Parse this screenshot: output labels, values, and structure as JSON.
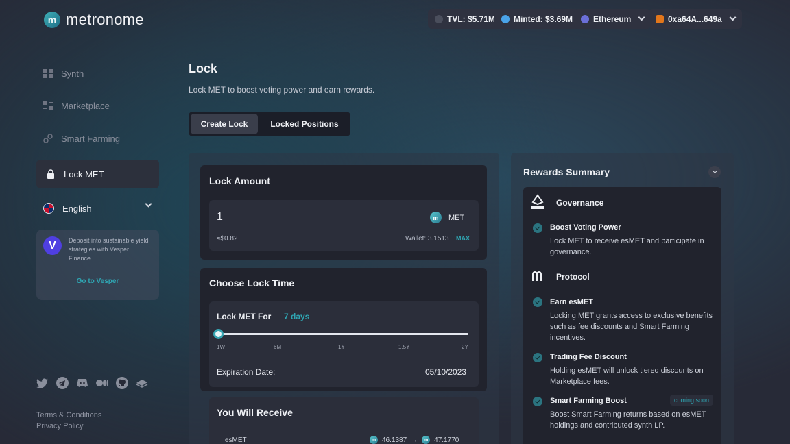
{
  "header": {
    "brand": "metronome",
    "tvl": "TVL: $5.71M",
    "minted": "Minted: $3.69M",
    "network": "Ethereum",
    "wallet": "0xa64A...649a"
  },
  "sidebar": {
    "items": [
      {
        "label": "Synth",
        "icon": "grid-icon"
      },
      {
        "label": "Marketplace",
        "icon": "marketplace-icon"
      },
      {
        "label": "Smart Farming",
        "icon": "link-icon"
      },
      {
        "label": "Lock MET",
        "icon": "lock-icon"
      }
    ],
    "language": "English",
    "promo": {
      "text": "Deposit into sustainable yield strategies with Vesper Finance.",
      "link": "Go to Vesper"
    },
    "footer": {
      "terms": "Terms & Conditions",
      "privacy": "Privacy Policy"
    }
  },
  "main": {
    "title": "Lock",
    "subtitle": "Lock MET to boost voting power and earn rewards.",
    "tabs": [
      {
        "label": "Create Lock",
        "active": true
      },
      {
        "label": "Locked Positions",
        "active": false
      }
    ],
    "lock_amount": {
      "title": "Lock Amount",
      "value": "1",
      "token": "MET",
      "usd": "≈$0.82",
      "wallet": "Wallet: 3.1513",
      "max": "MAX"
    },
    "lock_time": {
      "title": "Choose Lock Time",
      "label": "Lock MET For",
      "duration": "7 days",
      "slider_fraction": 0.0,
      "ticks": [
        "1W",
        "6M",
        "1Y",
        "1.5Y",
        "2Y"
      ],
      "expiration_label": "Expiration Date:",
      "expiration_value": "05/10/2023"
    },
    "receive": {
      "title": "You Will Receive",
      "token": "esMET",
      "from": "46.1387",
      "arrow": "→",
      "to": "47.1770"
    }
  },
  "rewards": {
    "title": "Rewards Summary",
    "governance": {
      "title": "Governance",
      "items": [
        {
          "title": "Boost Voting Power",
          "desc": "Lock MET to receive esMET and participate in governance."
        }
      ]
    },
    "protocol": {
      "title": "Protocol",
      "items": [
        {
          "title": "Earn esMET",
          "desc": "Locking MET grants access to exclusive benefits such as fee discounts and Smart Farming incentives."
        },
        {
          "title": "Trading Fee Discount",
          "desc": "Holding esMET will unlock tiered discounts on Marketplace fees."
        },
        {
          "title": "Smart Farming Boost",
          "desc": "Boost Smart Farming returns based on esMET holdings and contributed synth LP.",
          "badge": "coming soon"
        }
      ]
    }
  },
  "colors": {
    "accent": "#2fa6b3",
    "background": "#272a37",
    "card": "#21232d"
  }
}
